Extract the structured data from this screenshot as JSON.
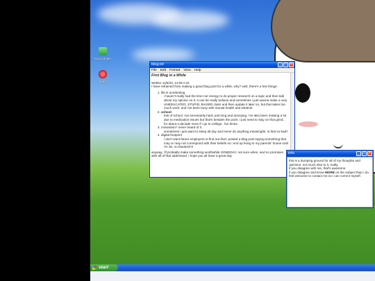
{
  "desktop": {
    "icons": [
      {
        "label": "Recycle Bin",
        "icon": "recycle-bin-icon"
      },
      {
        "label": "Opera",
        "icon": "opera-icon"
      }
    ]
  },
  "blog_window": {
    "title": "blog.txt",
    "menu": [
      "File",
      "Edit",
      "Format",
      "View",
      "Help"
    ],
    "heading": "First Blog in a While",
    "lines": [
      "Written 11/5/23, 12:06 A.M.",
      "I have refrained from making a good blog post for a while, why? well, there's a few things:"
    ],
    "items": [
      {
        "title": "life is unrelenting",
        "text": "i haven't really had the time nor energy to do proper research on a topic and then talk about my opinion on it. it can be really tedious and sometimes i just wanna make a very UNEDUCATED, STUPID, BIASED claim and then update it later on, but that takes too much work. and i've been busy with mental health and whatnot"
      },
      {
        "title": "school",
        "text": "lots of school. not necessarily hard, just long and annoying. i've also been missing a lot due to medication issues but that's besides the point. i just need to stay on that grind.. for about a decade more if i go to college.. fun times."
      },
      {
        "title": "motivation? never heard of it.",
        "text": "sometimes i just want to sleep all day and never do anything meaningful. is that so bad?"
      },
      {
        "title": "digital footprint",
        "text": "i don't want future employers to find out that i posted a blog post saying something that may or may not correspond with their beliefs so i end up living in my parents' house until i'm 30. no thanks!!!!!!"
      }
    ],
    "closing": "anyway, i'll probably make something worthwhile SOMEDAY, not sure when, and no promises. with all of that addressed, i hope you all have a great day"
  },
  "info_window": {
    "title": "info",
    "lines_before": "this is a dumping ground for all of my thoughts and opinions. not much else to it, really.",
    "line2": "if you disagree with me, that's awesome.",
    "line3_pre": "if you disagree and know ",
    "line3_bold": "MORE",
    "line3_post": " on the subject than i do, feel welcome to contact me so i can correct myself."
  },
  "taskbar": {
    "start_label": "start"
  }
}
